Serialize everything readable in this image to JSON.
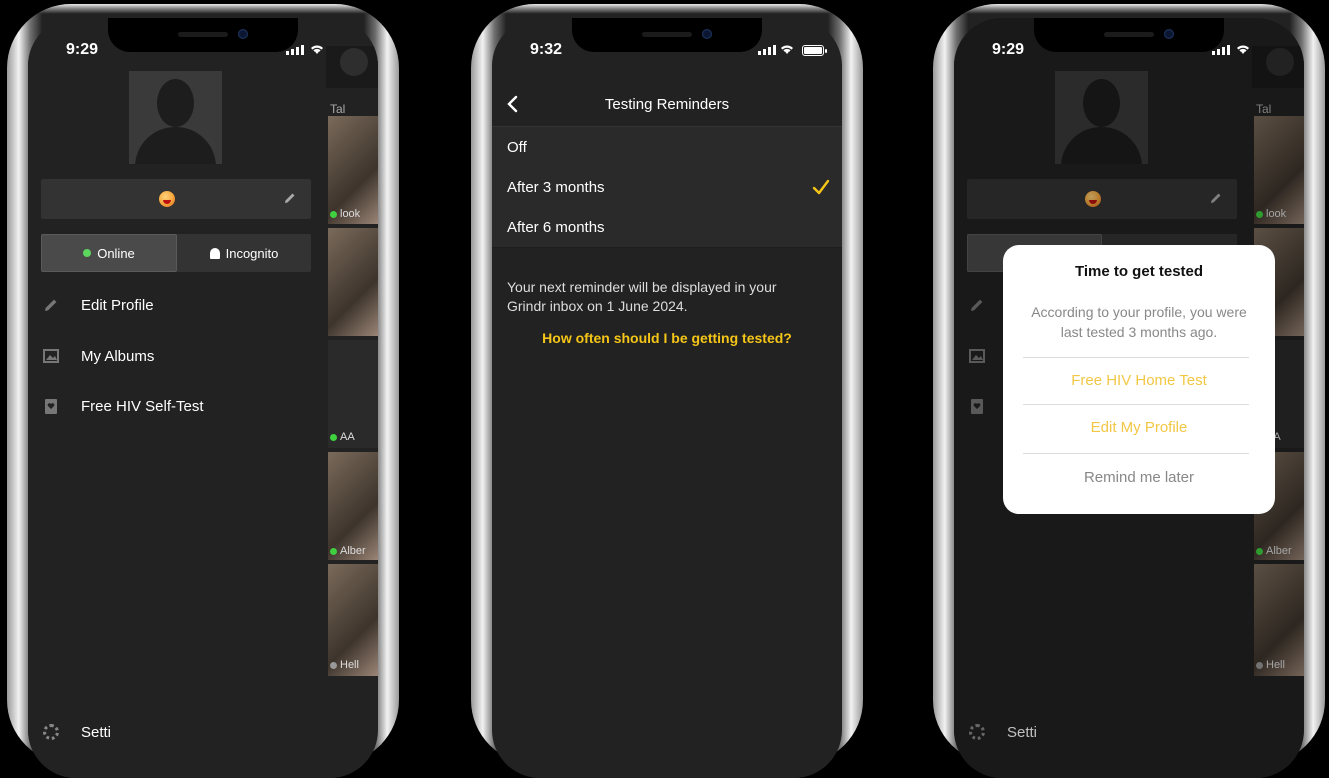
{
  "phones": [
    {
      "status": {
        "time": "9:29"
      },
      "drawer": {
        "profile_emoji": "red-face-emoji",
        "toggle": {
          "online": "Online",
          "incognito": "Incognito",
          "selected": "Online"
        },
        "menu": [
          {
            "label": "Edit Profile",
            "icon": "pencil-icon"
          },
          {
            "label": "My Albums",
            "icon": "image-icon"
          },
          {
            "label": "Free HIV Self-Test",
            "icon": "heart-card-icon"
          }
        ],
        "settings_partial": "Setti"
      },
      "peek": {
        "tab": "Tal",
        "labels": [
          "look",
          "AA",
          "Alber",
          "Hell"
        ]
      }
    },
    {
      "status": {
        "time": "9:32"
      },
      "nav": {
        "title": "Testing Reminders"
      },
      "options": [
        {
          "label": "Off",
          "selected": false
        },
        {
          "label": "After 3 months",
          "selected": true
        },
        {
          "label": "After 6 months",
          "selected": false
        }
      ],
      "note": {
        "line1": "Your next reminder will be displayed in your",
        "line2": "Grindr inbox on 1 June 2024."
      },
      "help_link": "How often should I be getting tested?",
      "accent": "#f5c518"
    },
    {
      "status": {
        "time": "9:29"
      },
      "modal": {
        "title": "Time to get tested",
        "body_line1": "According to your profile, you were",
        "body_line2": "last tested 3 months ago.",
        "actions": [
          {
            "label": "Free HIV Home Test",
            "style": "accent"
          },
          {
            "label": "Edit My Profile",
            "style": "accent"
          },
          {
            "label": "Remind me later",
            "style": "muted"
          }
        ]
      },
      "peek": {
        "tab": "Tal",
        "labels": [
          "look",
          "AA",
          "Alber",
          "Hell"
        ]
      }
    }
  ]
}
